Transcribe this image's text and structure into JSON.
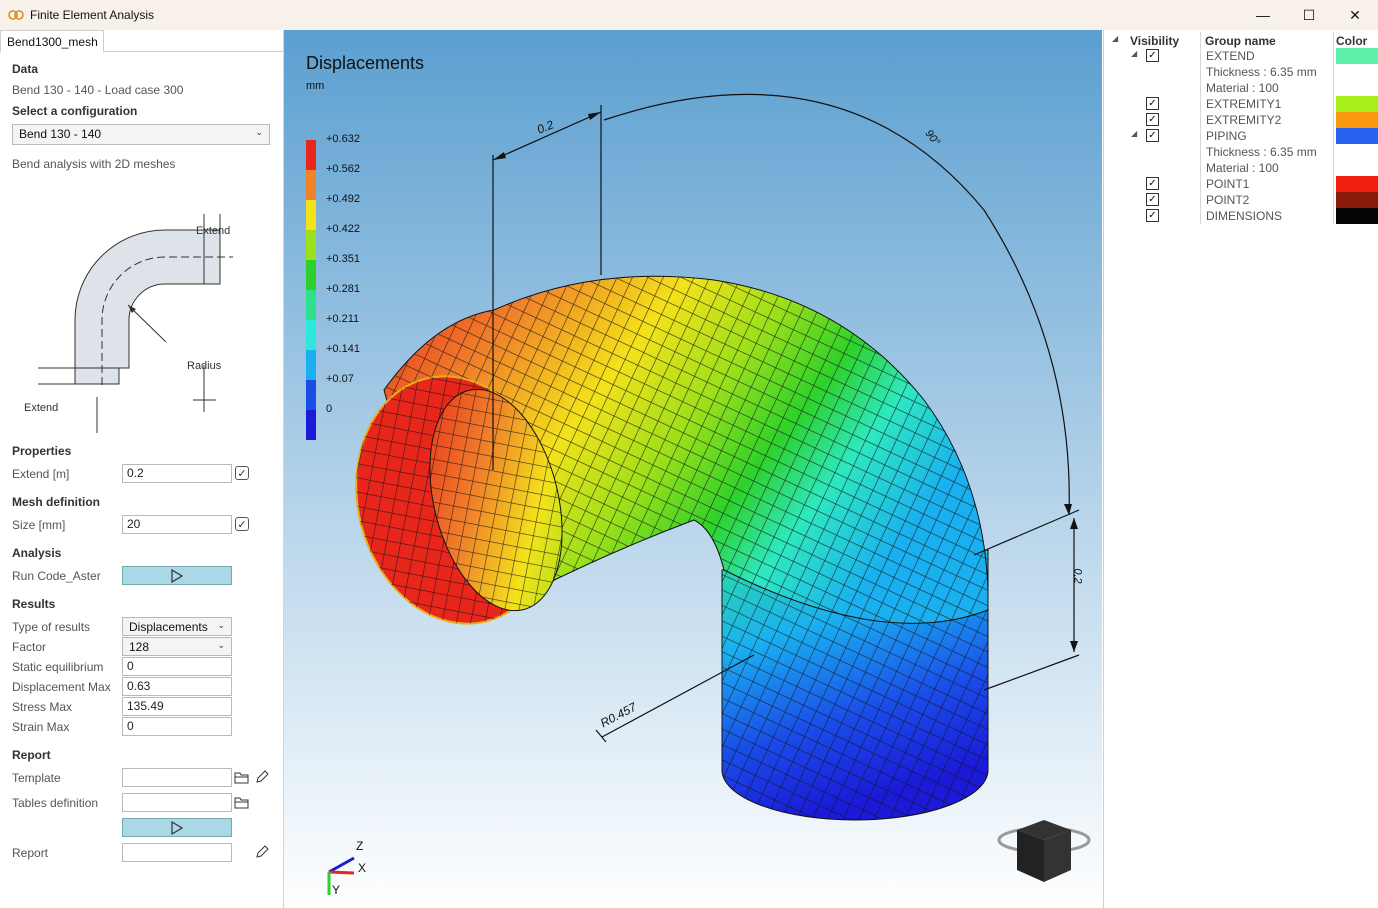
{
  "window": {
    "title": "Finite Element Analysis",
    "minimize": "—",
    "maximize": "☐",
    "close": "✕"
  },
  "tab": {
    "label": "Bend1300_mesh"
  },
  "data_section": {
    "title": "Data",
    "description": "Bend 130 - 140 - Load case 300",
    "config_title": "Select a configuration",
    "config_value": "Bend 130 - 140",
    "analysis_note": "Bend analysis with 2D meshes"
  },
  "diagram": {
    "extend_top": "Extend",
    "extend_bottom": "Extend",
    "radius": "Radius"
  },
  "properties": {
    "title": "Properties",
    "extend_label": "Extend [m]",
    "extend_value": "0.2"
  },
  "mesh": {
    "title": "Mesh definition",
    "size_label": "Size [mm]",
    "size_value": "20"
  },
  "analysis": {
    "title": "Analysis",
    "run_label": "Run Code_Aster"
  },
  "results": {
    "title": "Results",
    "type_label": "Type of results",
    "type_value": "Displacements",
    "factor_label": "Factor",
    "factor_value": "128",
    "static_label": "Static equilibrium",
    "static_value": "0",
    "disp_label": "Displacement Max",
    "disp_value": "0.63",
    "stress_label": "Stress Max",
    "stress_value": "135.49",
    "strain_label": "Strain Max",
    "strain_value": "0"
  },
  "report": {
    "title": "Report",
    "template_label": "Template",
    "template_value": "",
    "tables_label": "Tables definition",
    "tables_value": "",
    "report_label": "Report",
    "report_value": ""
  },
  "viewport": {
    "title": "Displacements",
    "unit": "mm",
    "legend": [
      {
        "label": "+0.632",
        "color": "#e8261c"
      },
      {
        "label": "+0.562",
        "color": "#f0822a"
      },
      {
        "label": "+0.492",
        "color": "#f4e21a"
      },
      {
        "label": "+0.422",
        "color": "#9be01a"
      },
      {
        "label": "+0.351",
        "color": "#2ed12a"
      },
      {
        "label": "+0.281",
        "color": "#2ee08c"
      },
      {
        "label": "+0.211",
        "color": "#2ee8e0"
      },
      {
        "label": "+0.141",
        "color": "#1ab0f0"
      },
      {
        "label": "+0.07",
        "color": "#1a4ce8"
      },
      {
        "label": "0",
        "color": "#1a1ad8"
      }
    ],
    "dim_top": "0.2",
    "dim_angle": "90°",
    "dim_right": "0.2",
    "dim_radius": "R0.457",
    "axis_z": "Z",
    "axis_x": "X",
    "axis_y": "Y"
  },
  "groups": {
    "header_visibility": "Visibility",
    "header_name": "Group name",
    "header_color": "Color",
    "rows": [
      {
        "name": "EXTEND",
        "checked": "✓",
        "expander": "◢",
        "color": "#5ef0a8"
      },
      {
        "name": "Thickness : 6.35 mm",
        "color": ""
      },
      {
        "name": "Material : 100",
        "color": ""
      },
      {
        "name": "EXTREMITY1",
        "checked": "✓",
        "color": "#a8f01a"
      },
      {
        "name": "EXTREMITY2",
        "checked": "✓",
        "color": "#fb9a0e"
      },
      {
        "name": "PIPING",
        "checked": "✓",
        "expander": "◢",
        "color": "#2a62f0"
      },
      {
        "name": "Thickness : 6.35 mm",
        "color": ""
      },
      {
        "name": "Material : 100",
        "color": ""
      },
      {
        "name": "POINT1",
        "checked": "✓",
        "color": "#f01e0e"
      },
      {
        "name": "POINT2",
        "checked": "✓",
        "color": "#8a1a0a"
      },
      {
        "name": "DIMENSIONS",
        "checked": "✓",
        "color": "#050505"
      }
    ]
  }
}
